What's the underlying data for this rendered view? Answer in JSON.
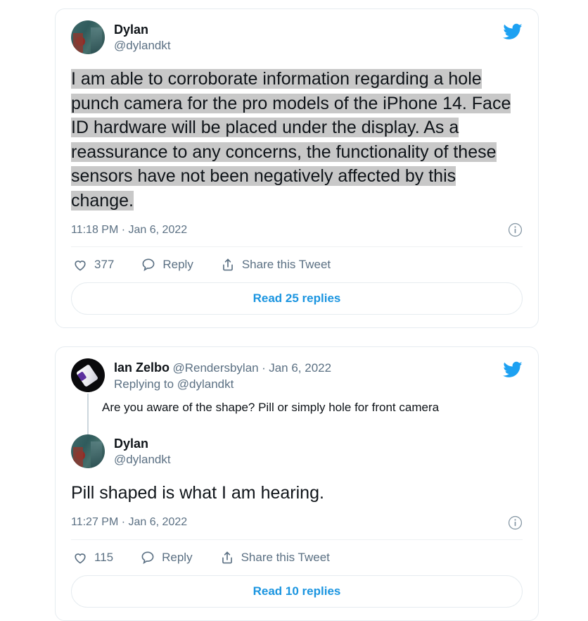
{
  "colors": {
    "brand_blue": "#1da1f2",
    "link_blue": "#1b95e0",
    "text_primary": "#0f1419",
    "text_secondary": "#5b7083",
    "card_border": "#e6ecf0",
    "selection_gray": "#c8c8c8",
    "page_background": "#ffffff"
  },
  "tweets": [
    {
      "author": {
        "display_name": "Dylan",
        "handle": "@dylandkt",
        "avatar_name": "dylan-avatar"
      },
      "body_lines": [
        "I am able to corroborate information regarding a hole",
        "punch camera for the pro models of the iPhone 14. Face",
        "ID hardware will be placed under the display. As a",
        "reassurance to any concerns, the functionality of these",
        "sensors have not been negatively affected by this change."
      ],
      "body_selected": true,
      "timestamp": "11:18 PM · Jan 6, 2022",
      "actions": {
        "like_count": "377",
        "reply_label": "Reply",
        "share_label": "Share this Tweet"
      },
      "read_replies_label": "Read 25 replies"
    },
    {
      "author": {
        "display_name": "Ian Zelbo",
        "handle": "@Rendersbylan",
        "separator": "·",
        "date": "Jan 6, 2022",
        "avatar_name": "ian-zelbo-avatar"
      },
      "replying_to": "Replying to @dylandkt",
      "quoted_text": "Are you aware of the shape? Pill or simply hole for front camera",
      "reply_author": {
        "display_name": "Dylan",
        "handle": "@dylandkt",
        "avatar_name": "dylan-avatar"
      },
      "body_lines": [
        "Pill shaped is what I am hearing."
      ],
      "body_selected": false,
      "timestamp": "11:27 PM · Jan 6, 2022",
      "actions": {
        "like_count": "115",
        "reply_label": "Reply",
        "share_label": "Share this Tweet"
      },
      "read_replies_label": "Read 10 replies"
    }
  ]
}
